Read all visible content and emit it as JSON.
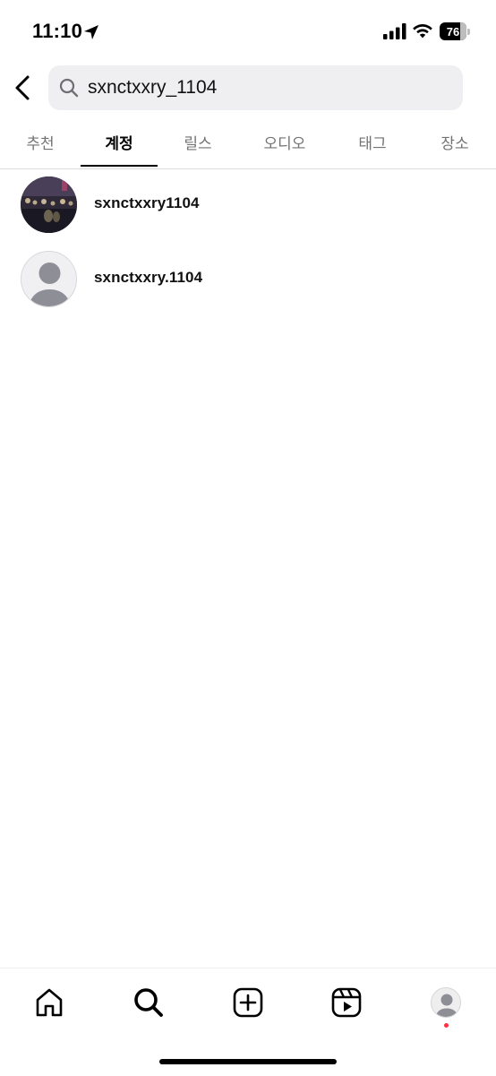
{
  "status_bar": {
    "time": "11:10",
    "battery_percent": "76",
    "battery_level": 0.76,
    "icons": [
      "location-arrow-icon",
      "cellular-signal-icon",
      "wifi-icon",
      "battery-icon"
    ]
  },
  "search": {
    "query": "sxnctxxry_1104",
    "icon": "search-icon",
    "back_icon": "chevron-left-icon"
  },
  "tabs": [
    {
      "label": "추천",
      "active": false
    },
    {
      "label": "계정",
      "active": true
    },
    {
      "label": "릴스",
      "active": false
    },
    {
      "label": "오디오",
      "active": false
    },
    {
      "label": "태그",
      "active": false
    },
    {
      "label": "장소",
      "active": false
    }
  ],
  "results": [
    {
      "username": "sxnctxxry1104",
      "avatar": "photo"
    },
    {
      "username": "sxnctxxry.1104",
      "avatar": "default-profile-icon"
    }
  ],
  "bottom_nav": {
    "items": [
      "home-icon",
      "search-icon",
      "create-post-icon",
      "reels-icon",
      "profile-icon"
    ],
    "active": "search-icon",
    "notification_dot": true
  },
  "colors": {
    "background": "#ffffff",
    "search_box": "#efeff1",
    "inactive_tab": "#737373",
    "divider": "#dbdbdb",
    "notification_dot": "#ff3040"
  }
}
